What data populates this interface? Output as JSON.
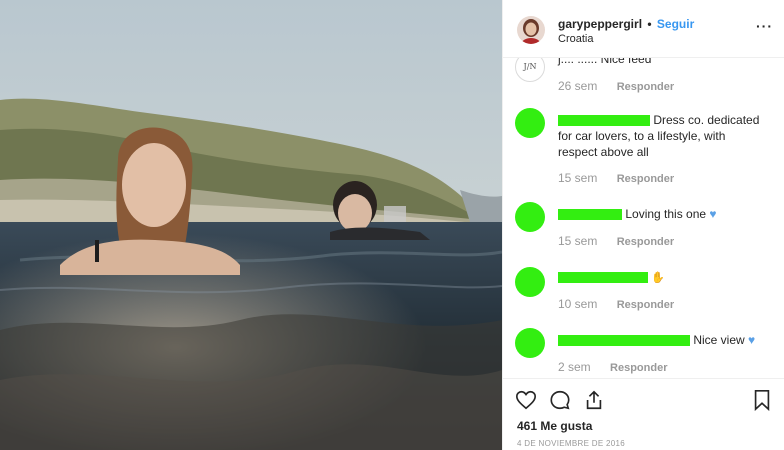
{
  "post": {
    "username": "garypeppergirl",
    "separator": "•",
    "follow_label": "Seguir",
    "location": "Croatia",
    "more_label": "···"
  },
  "comments": [
    {
      "avatar": "J/N",
      "text": "j...: ...... Nice feed",
      "time": "26 sem",
      "reply": "Responder"
    },
    {
      "redacted": true,
      "text": "Dress co. dedicated for car lovers, to a lifestyle, with respect above all",
      "time": "15 sem",
      "reply": "Responder"
    },
    {
      "redacted": true,
      "text": "Loving this one",
      "emoji": "blue-heart",
      "time": "15 sem",
      "reply": "Responder"
    },
    {
      "redacted": true,
      "text": "",
      "emoji": "ok-hand",
      "time": "10 sem",
      "reply": "Responder"
    },
    {
      "redacted": true,
      "text": "Nice view",
      "emoji": "blue-heart",
      "time": "2 sem",
      "reply": "Responder"
    }
  ],
  "footer": {
    "likes": "461 Me gusta",
    "date": "4 DE NOVIEMBRE DE 2016"
  },
  "colors": {
    "follow": "#3897f0",
    "redaction": "#33ee11",
    "muted": "#999999"
  }
}
